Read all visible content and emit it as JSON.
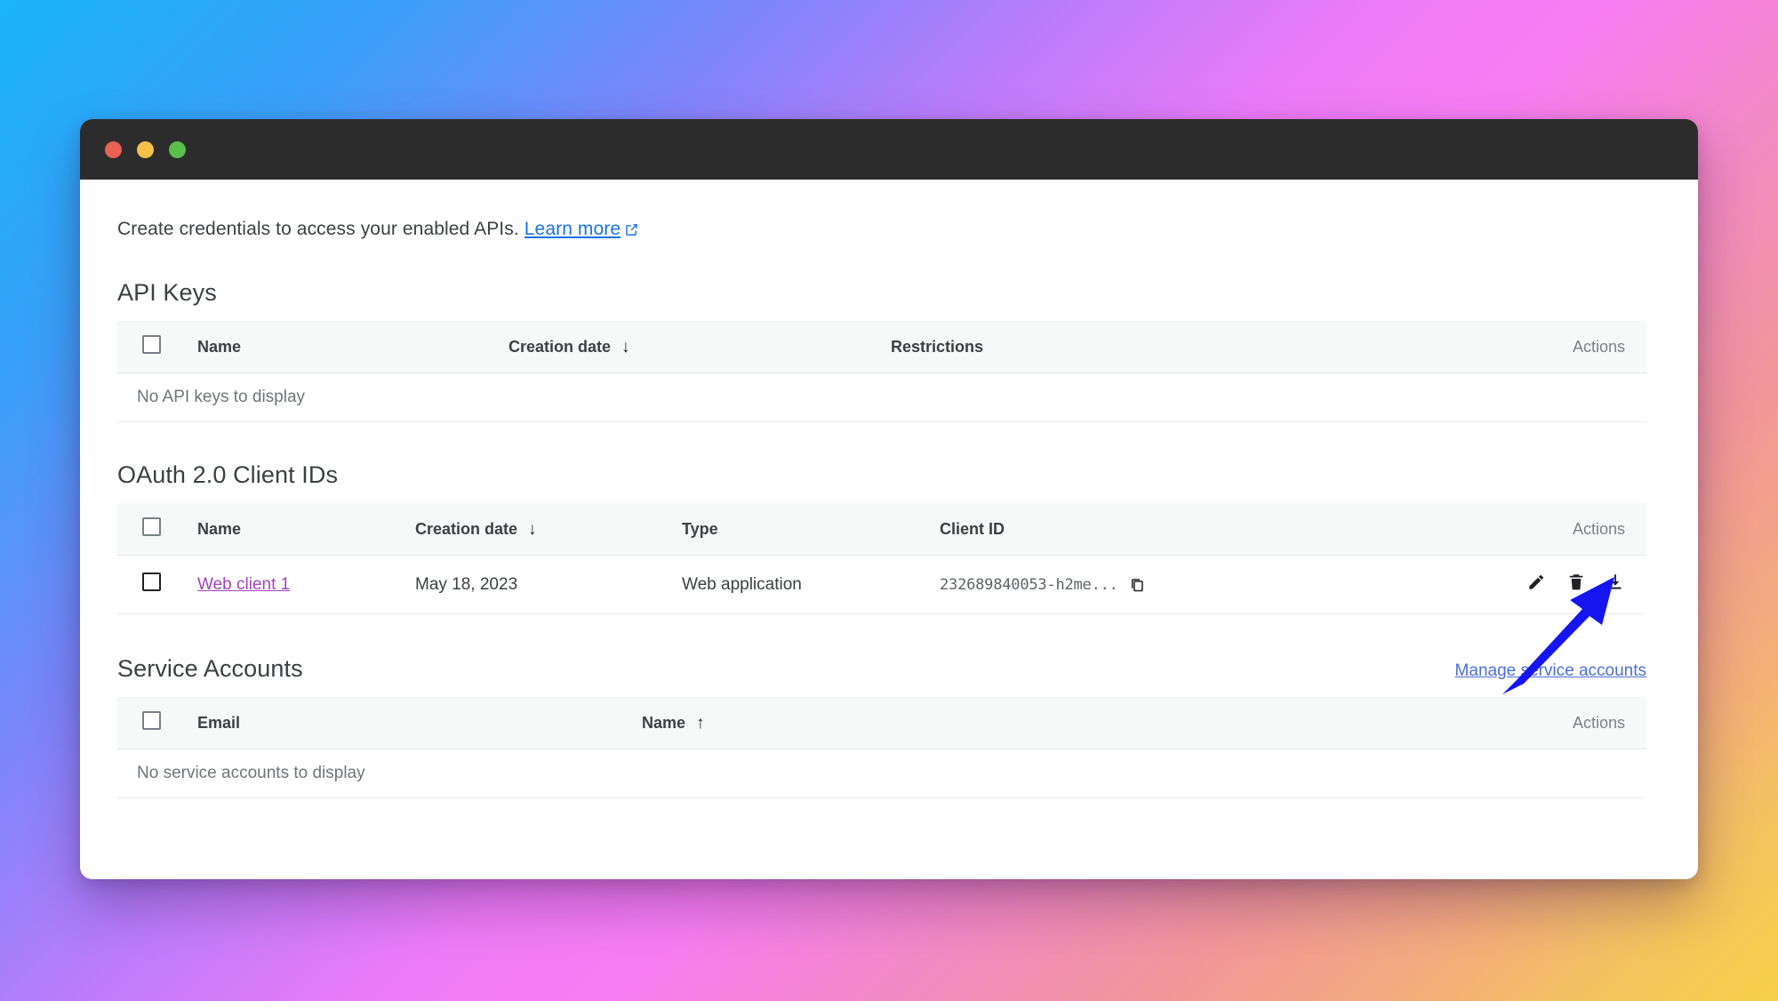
{
  "window": {
    "traffic_lights": [
      {
        "name": "close",
        "color": "#ea6055"
      },
      {
        "name": "minimize",
        "color": "#f3c04a"
      },
      {
        "name": "maximize",
        "color": "#59c14b"
      }
    ]
  },
  "intro": {
    "text": "Create credentials to access your enabled APIs.",
    "link_label": "Learn more",
    "link_icon": "external-link-icon"
  },
  "sections": {
    "api_keys": {
      "title": "API Keys",
      "columns": [
        "Name",
        "Creation date",
        "Restrictions",
        "Actions"
      ],
      "sort_column": "Creation date",
      "sort_direction": "↓",
      "empty_message": "No API keys to display",
      "rows": []
    },
    "oauth": {
      "title": "OAuth 2.0 Client IDs",
      "columns": [
        "Name",
        "Creation date",
        "Type",
        "Client ID",
        "Actions"
      ],
      "sort_column": "Creation date",
      "sort_direction": "↓",
      "rows": [
        {
          "name": "Web client 1",
          "creation_date": "May 18, 2023",
          "type": "Web application",
          "client_id": "232689840053-h2me...",
          "copy_icon": "copy-icon",
          "actions": [
            "edit-icon",
            "delete-icon",
            "download-icon"
          ]
        }
      ]
    },
    "service_accounts": {
      "title": "Service Accounts",
      "manage_link": "Manage service accounts",
      "columns": [
        "Email",
        "Name",
        "Actions"
      ],
      "sort_column": "Name",
      "sort_direction": "↑",
      "empty_message": "No service accounts to display",
      "rows": []
    }
  },
  "annotation": {
    "type": "arrow",
    "color": "#1515f0",
    "points_to": "download-icon"
  },
  "colors": {
    "link": "#1a73e8",
    "visited_link": "#a144b8",
    "manage_link": "#4a6fdc",
    "text": "#3c4043",
    "muted_text": "#70757a",
    "table_header_bg": "#f7f8f8",
    "annotation": "#1515f0"
  }
}
